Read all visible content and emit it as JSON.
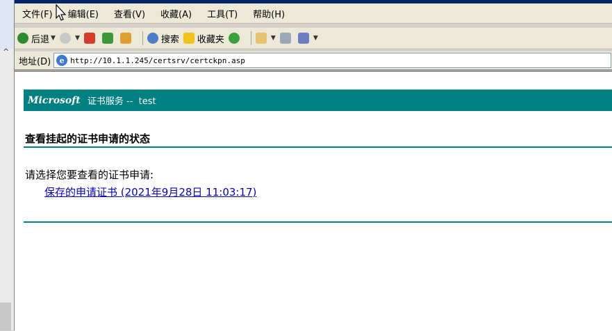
{
  "menu": [
    "文件(F)",
    "编辑(E)",
    "查看(V)",
    "收藏(A)",
    "工具(T)",
    "帮助(H)"
  ],
  "toolbar": {
    "back_label": "后退",
    "search_label": "搜索",
    "favorites_label": "收藏夹"
  },
  "address": {
    "label": "地址(D)",
    "url": "http://10.1.1.245/certsrv/certckpn.asp"
  },
  "page": {
    "brand": "Microsoft",
    "service_title": " 证书服务 --  test",
    "heading": "查看挂起的证书申请的状态",
    "prompt": "请选择您要查看的证书申请:",
    "request_link": "保存的申请证书 (2021年9月28日 11:03:17)"
  },
  "colors": {
    "accent": "#008080",
    "link": "#0000cc",
    "chrome": "#ece9d8"
  }
}
